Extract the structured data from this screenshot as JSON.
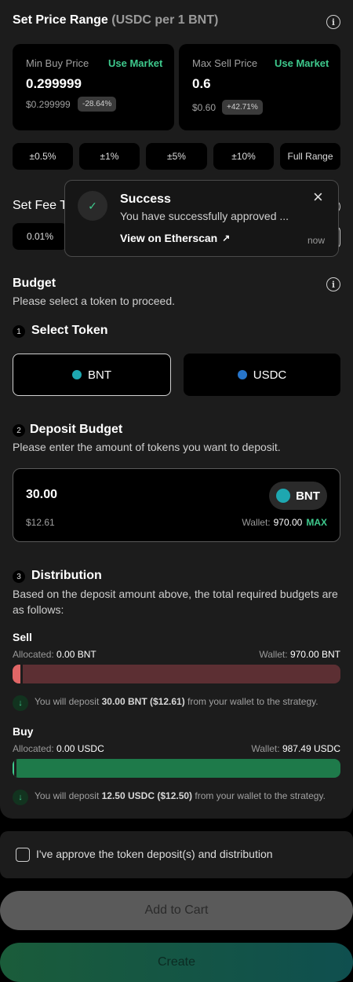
{
  "price_range": {
    "title": "Set Price Range",
    "subtitle": "(USDC per 1 BNT)",
    "min_buy": {
      "label": "Min Buy Price",
      "use_market": "Use Market",
      "value": "0.299999",
      "fiat": "$0.299999",
      "change": "-28.64%"
    },
    "max_sell": {
      "label": "Max Sell Price",
      "use_market": "Use Market",
      "value": "0.6",
      "fiat": "$0.60",
      "change": "+42.71%"
    },
    "range_buttons": [
      "±0.5%",
      "±1%",
      "±5%",
      "±10%",
      "Full Range"
    ]
  },
  "fee_tier": {
    "title_partial": "Set Fee T",
    "option": "0.01%"
  },
  "toast": {
    "title": "Success",
    "message": "You have successfully approved ...",
    "link": "View on Etherscan",
    "time": "now"
  },
  "budget": {
    "title": "Budget",
    "subtitle": "Please select a token to proceed.",
    "step1": {
      "num": "1",
      "title": "Select Token"
    },
    "tokens": [
      "BNT",
      "USDC"
    ],
    "step2": {
      "num": "2",
      "title": "Deposit Budget",
      "desc": "Please enter the amount of tokens you want to deposit."
    },
    "deposit": {
      "amount": "30.00",
      "token": "BNT",
      "fiat": "$12.61",
      "wallet_label": "Wallet:",
      "wallet_value": "970.00",
      "max": "MAX"
    },
    "step3": {
      "num": "3",
      "title": "Distribution",
      "desc": "Based on the deposit amount above, the total required budgets are as follows:"
    },
    "sell": {
      "title": "Sell",
      "allocated_label": "Allocated:",
      "allocated_value": "0.00 BNT",
      "wallet_label": "Wallet:",
      "wallet_value": "970.00 BNT",
      "fill": 0.03,
      "note_pre": "You will deposit",
      "note_amount": "30.00 BNT",
      "note_fiat": "($12.61)",
      "note_post": "from your wallet to the strategy."
    },
    "buy": {
      "title": "Buy",
      "allocated_label": "Allocated:",
      "allocated_value": "0.00 USDC",
      "wallet_label": "Wallet:",
      "wallet_value": "987.49 USDC",
      "fill": 0.013,
      "note_pre": "You will deposit",
      "note_amount": "12.50 USDC",
      "note_fiat": "($12.50)",
      "note_post": "from your wallet to the strategy."
    }
  },
  "approve": {
    "label": "I've approve the token deposit(s) and distribution"
  },
  "actions": {
    "add_to_cart": "Add to Cart",
    "create": "Create"
  },
  "colors": {
    "accent_green": "#3ec98d",
    "sell_red": "#e06666",
    "buy_green": "#1e7a4a"
  }
}
